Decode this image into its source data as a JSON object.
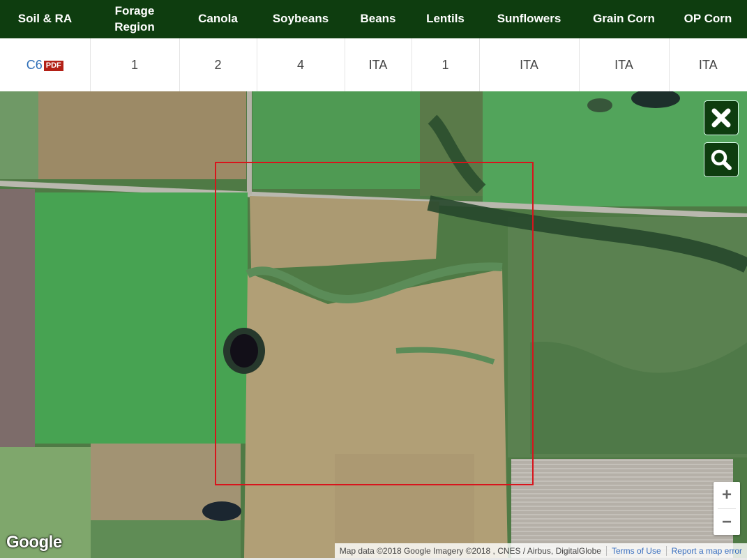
{
  "table": {
    "headers": [
      {
        "key": "soil",
        "label": "Soil & RA"
      },
      {
        "key": "forage1",
        "label": "Forage"
      },
      {
        "key": "canola",
        "label": "Canola"
      },
      {
        "key": "soybeans",
        "label": "Soybeans"
      },
      {
        "key": "beans",
        "label": "Beans"
      },
      {
        "key": "lentils",
        "label": "Lentils"
      },
      {
        "key": "sunflowers",
        "label": "Sunflowers"
      },
      {
        "key": "graincorn",
        "label": "Grain Corn"
      },
      {
        "key": "opcorn",
        "label": "OP Corn"
      }
    ],
    "forage_line2": "Region",
    "row": {
      "soil_link": "C6",
      "pdf_badge": "PDF",
      "forage": "1",
      "canola": "2",
      "soybeans": "4",
      "beans": "ITA",
      "lentils": "1",
      "sunflowers": "ITA",
      "graincorn": "ITA",
      "opcorn": "ITA"
    }
  },
  "map": {
    "logo": "Google",
    "attribution": "Map data ©2018 Google Imagery ©2018 , CNES / Airbus, DigitalGlobe",
    "terms_label": "Terms of Use",
    "report_label": "Report a map error",
    "zoom_in": "+",
    "zoom_out": "−",
    "icons": {
      "close": "close-icon",
      "search": "search-icon"
    },
    "selection_color": "#d8141c"
  },
  "colors": {
    "header_bg": "#0e3d0f",
    "link": "#2f6fb8",
    "pdf_badge": "#b32016"
  }
}
